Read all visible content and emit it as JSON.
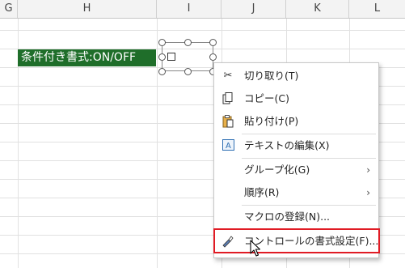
{
  "columns": [
    "G",
    "H",
    "I",
    "J",
    "K",
    "L"
  ],
  "cell": {
    "text": "条件付き書式:ON/OFF",
    "background": "#1f6e2a",
    "color": "#ffffff"
  },
  "context_menu": {
    "items": [
      {
        "label": "切り取り(T)",
        "icon": "scissors-icon"
      },
      {
        "label": "コピー(C)",
        "icon": "copy-icon"
      },
      {
        "label": "貼り付け(P)",
        "icon": "paste-icon"
      },
      {
        "label": "テキストの編集(X)",
        "icon": "edit-text-icon"
      },
      {
        "label": "グループ化(G)",
        "submenu": "›"
      },
      {
        "label": "順序(R)",
        "submenu": "›"
      },
      {
        "label": "マクロの登録(N)..."
      },
      {
        "label": "コントロールの書式設定(F)...",
        "icon": "format-control-icon",
        "highlighted": true
      }
    ]
  },
  "highlight_color": "#e01b24"
}
